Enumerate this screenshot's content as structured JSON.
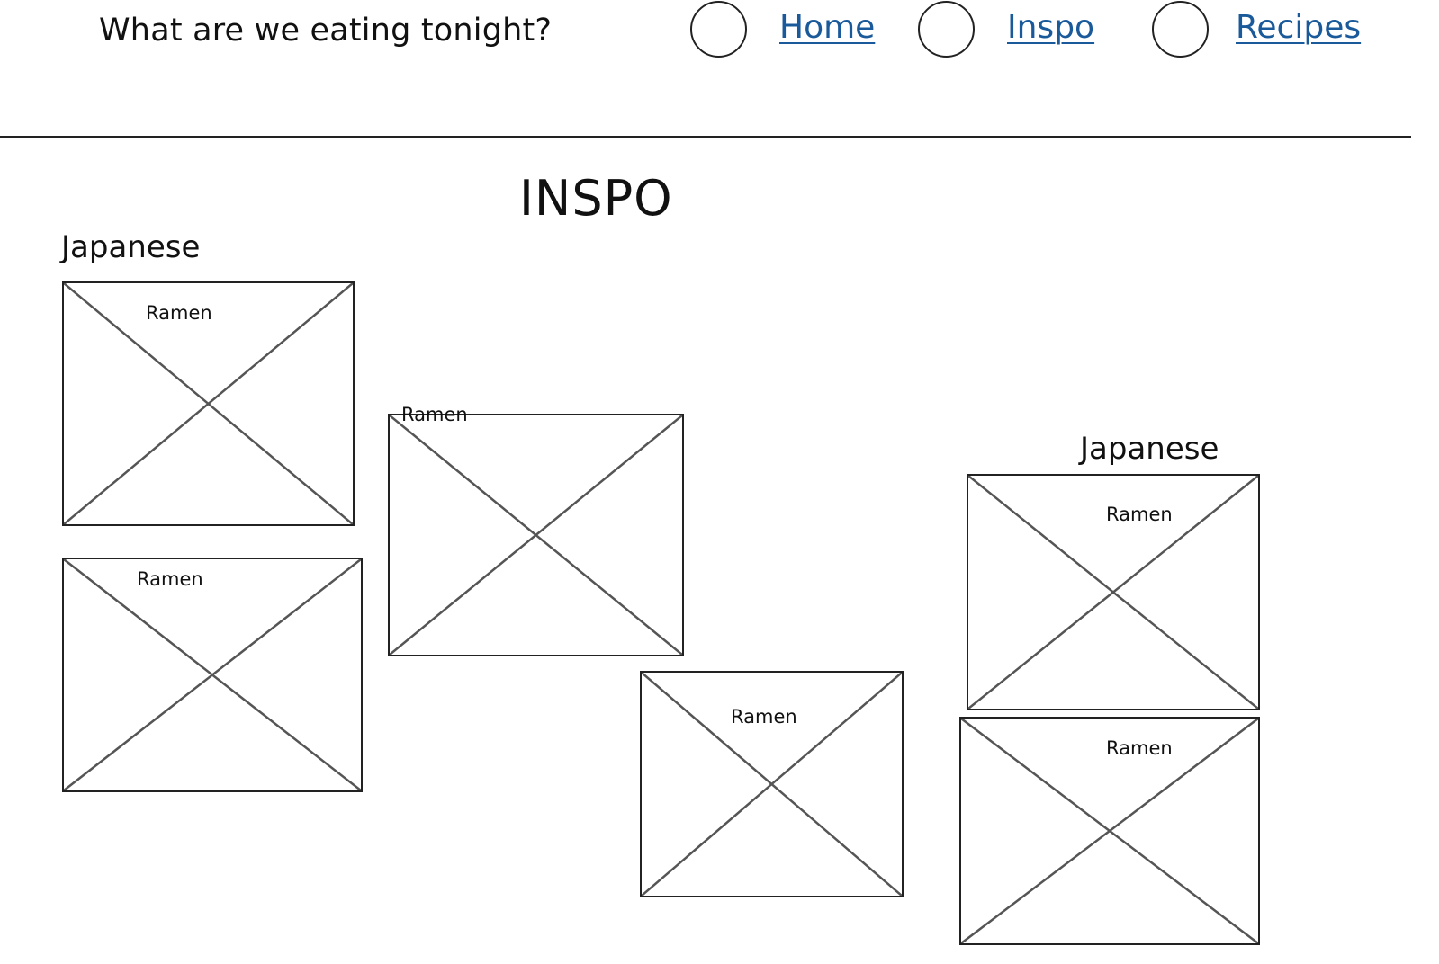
{
  "header": {
    "title": "What are we eating tonight?",
    "nav": [
      {
        "label": "Home",
        "icon": "placeholder-circle-icon"
      },
      {
        "label": "Inspo",
        "icon": "placeholder-circle-icon"
      },
      {
        "label": "Recipes",
        "icon": "placeholder-circle-icon"
      }
    ]
  },
  "main": {
    "page_title": "INSPO",
    "sections": [
      {
        "heading": "Japanese"
      },
      {
        "heading": "Japanese"
      }
    ],
    "cards": [
      {
        "label": "Ramen",
        "image_icon": "image-placeholder-icon"
      },
      {
        "label": "Ramen",
        "image_icon": "image-placeholder-icon"
      },
      {
        "label": "Ramen",
        "image_icon": "image-placeholder-icon"
      },
      {
        "label": "Ramen",
        "image_icon": "image-placeholder-icon"
      },
      {
        "label": "Ramen",
        "image_icon": "image-placeholder-icon"
      },
      {
        "label": "Ramen",
        "image_icon": "image-placeholder-icon"
      }
    ]
  },
  "colors": {
    "link": "#1a5a9a",
    "text": "#111111",
    "border": "#222222",
    "placeholder_cross": "#555555"
  }
}
